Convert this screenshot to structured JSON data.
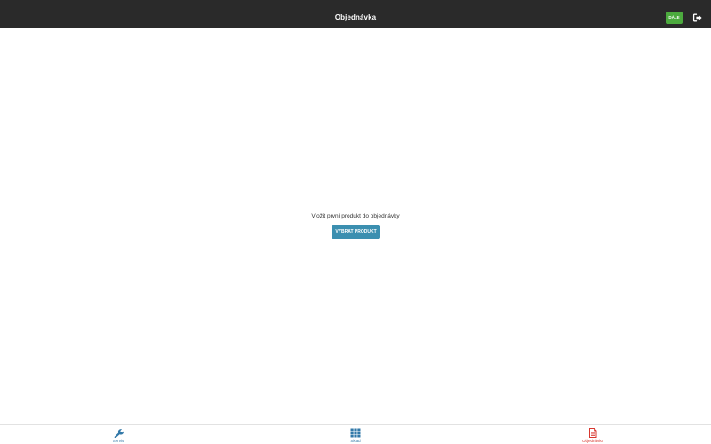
{
  "header": {
    "title": "Objednávka",
    "next_label": "DÁLE",
    "logout_icon": "sign-out-icon"
  },
  "main": {
    "empty_message": "Vložit první produkt do objednávky",
    "select_button_label": "VYBRAT PRODUKT"
  },
  "tabbar": {
    "items": [
      {
        "label": "Servis",
        "icon": "wrench-icon",
        "active": false
      },
      {
        "label": "Sklad",
        "icon": "grid-icon",
        "active": false
      },
      {
        "label": "Objednávka",
        "icon": "document-icon",
        "active": true
      }
    ]
  },
  "colors": {
    "header_bg": "#2a2a2a",
    "next_button": "#4caa3e",
    "primary_button": "#3b8fb0",
    "tab_inactive": "#3178a8",
    "tab_active": "#d8372f"
  }
}
